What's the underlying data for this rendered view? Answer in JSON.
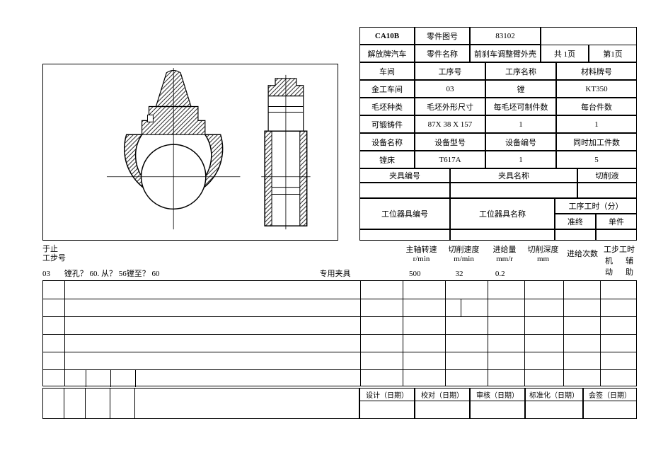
{
  "header": {
    "model": "CA10B",
    "part_drawing_no_label": "零件图号",
    "part_drawing_no": "83102",
    "vehicle": "解放牌汽车",
    "part_name_label": "零件名称",
    "part_name": "前刹车调整臂外壳",
    "page_total": "共 1页",
    "page_current": "第1页",
    "workshop_label": "车间",
    "process_no_label": "工序号",
    "process_name_label": "工序名称",
    "material_label": "材料牌号",
    "workshop": "金工车间",
    "process_no": "03",
    "process_name": "镗",
    "material": "KT350",
    "blank_type_label": "毛坯种类",
    "blank_dim_label": "毛坯外形尺寸",
    "blank_per_parts_label": "每毛坯可制件数",
    "per_machine_label": "每台件数",
    "blank_type": "可锻铸件",
    "blank_dim": "87X 38 X 157",
    "blank_per_parts": "1",
    "per_machine": "1",
    "device_name_label": "设备名称",
    "device_model_label": "设备型号",
    "device_no_label": "设备编号",
    "simul_label": "同时加工件数",
    "device_name": "镗床",
    "device_model": "T617A",
    "device_no": "1",
    "simul": "5",
    "fixture_no_label": "夹具编号",
    "fixture_name_label": "夹具名称",
    "coolant_label": "切削液",
    "tool_no_label": "工位器具编号",
    "tool_name_label": "工位器具名称",
    "proc_time_label": "工序工时（分）",
    "final_label": "准终",
    "unit_label": "单件"
  },
  "cols": {
    "step_no_label1": "于止",
    "step_no_label2": "工步号",
    "spindle_label": "主轴转速",
    "spindle_unit": "r/min",
    "cutspeed_label": "切削速度",
    "cutspeed_unit": "m/min",
    "feed_label": "进给量",
    "feed_unit": "mm/r",
    "depth_label": "切削深度",
    "depth_unit": "mm",
    "passes_label": "进给次数",
    "steptime_label": "工步工时",
    "machine_label": "机动",
    "aux_label": "辅助"
  },
  "row": {
    "no": "03",
    "desc": "镗孔？ 60. 从？ 56镗至？ 60",
    "fixture": "专用夹具",
    "spindle": "500",
    "cutspeed": "32",
    "feed": "0.2"
  },
  "footer": {
    "design": "设计（日期）",
    "check": "校对（日期）",
    "review": "审核（日期）",
    "standard": "标准化（日期）",
    "sign": "会签（日期）"
  }
}
